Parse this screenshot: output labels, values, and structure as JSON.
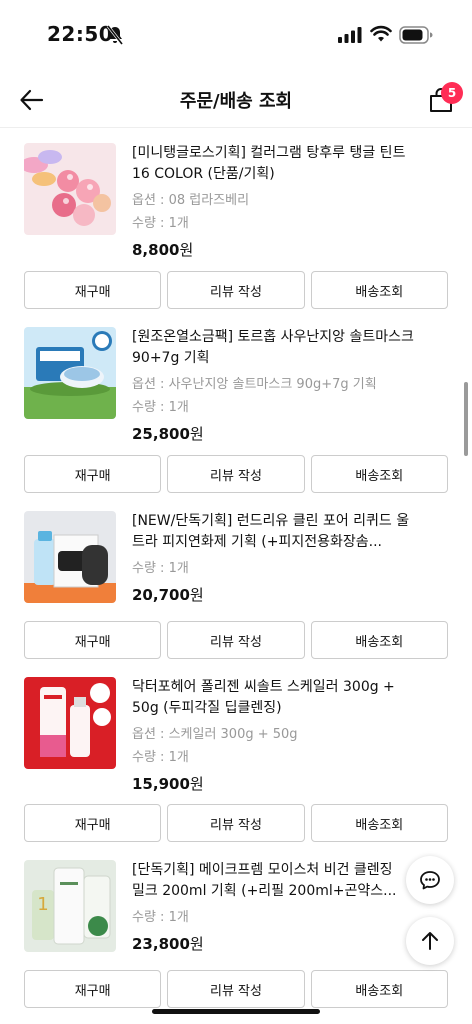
{
  "status": {
    "time": "22:50"
  },
  "header": {
    "title": "주문/배송 조회",
    "cart_count": "5"
  },
  "buttons": {
    "rebuy": "재구매",
    "review": "리뷰 작성",
    "track": "배송조회"
  },
  "items": [
    {
      "name": "[미니탱글로스기획] 컬러그램 탕후루 탱글 틴트 16 COLOR (단품/기획)",
      "option": "옵션 : 08 럽라즈베리",
      "qty": "수량 : 1개",
      "price": "8,800",
      "unit": "원"
    },
    {
      "name": "[원조온열소금팩] 토르홉 사우난지앙 솔트마스크 90+7g 기획",
      "option": "옵션 : 사우난지앙 솔트마스크 90g+7g 기획",
      "qty": "수량 : 1개",
      "price": "25,800",
      "unit": "원"
    },
    {
      "name": "[NEW/단독기획] 런드리유 클린 포어 리퀴드 울트라 피지연화제 기획 (+피지전용화장솜...",
      "option": "",
      "qty": "수량 : 1개",
      "price": "20,700",
      "unit": "원"
    },
    {
      "name": "닥터포헤어 폴리젠 씨솔트 스케일러 300g + 50g (두피각질 딥클렌징)",
      "option": "옵션 : 스케일러 300g + 50g",
      "qty": "수량 : 1개",
      "price": "15,900",
      "unit": "원"
    },
    {
      "name": "[단독기획] 메이크프렘 모이스처 비건 클렌징 밀크 200ml 기획 (+리필 200ml+곤약스...",
      "option": "",
      "qty": "수량 : 1개",
      "price": "23,800",
      "unit": "원"
    }
  ],
  "colors": {
    "badge": "#ff2d55",
    "border": "#cccccc",
    "muted": "#999999"
  }
}
